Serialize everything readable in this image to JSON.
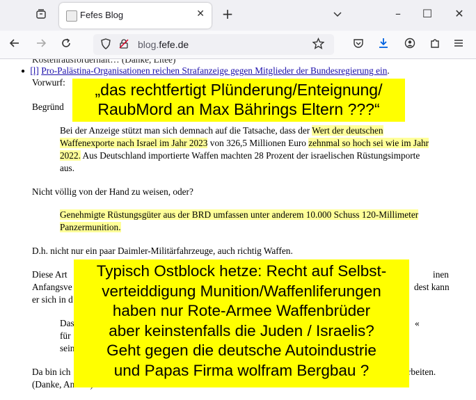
{
  "browser": {
    "tab_title": "Fefes Blog",
    "tab_close": "✕",
    "new_tab": "+",
    "url_prefix": "blog.",
    "url_domain": "fefe.de",
    "window_controls": {
      "minimize": "–",
      "maximize": "☐",
      "close": "✕"
    },
    "icons": [
      "tab-list-icon",
      "back-icon",
      "forward-icon",
      "reload-icon",
      "shield-icon",
      "permissions-icon",
      "bookmark-star-icon",
      "pocket-icon",
      "download-icon",
      "account-icon",
      "extensions-icon",
      "menu-icon"
    ]
  },
  "article": {
    "top_cut": "Kostenrausforderhalt… (Danke, Litee)",
    "bullet_marker": "[l]",
    "headline": "Pro-Palästina-Organisationen reichen Strafanzeige gegen Mitglieder der Bundesregierung ein",
    "headline_end": ".",
    "intro": "Vorwurf:",
    "begruendung": "Begründ",
    "quote1": {
      "part1": "Bei der Anzeige stützt man sich demnach auf die Tatsache, dass der ",
      "hl1": "Wert der deutschen Waffenexporte nach Israel im Jahr 2023",
      "part2": " von 326,5 Millionen Euro ",
      "hl2": "zehnmal so hoch sei wie im Jahr 2022.",
      "part3": " Aus Deutschland importierte Waffen machten 28 Prozent der israelischen Rüstungsimporte aus."
    },
    "comment1": "Nicht völlig von der Hand zu weisen, oder?",
    "quote2": "Genehmigte Rüstungsgüter aus der BRD umfassen unter anderem 10.000 Schuss 120-Millimeter Panzermunition.",
    "comment2": "D.h. nicht nur ein paar Daimler-Militärfahrzeuge, auch richtig Waffen.",
    "p3_line1_start": "Diese Art",
    "p3_line1_end": "inen",
    "p3_line2_start": "Anfangsve",
    "p3_line2_end": "dest kann",
    "p3_line3_start": "er sich in d",
    "q3_line1_start": "Das",
    "q3_line1_end": "«",
    "q3_line2_start": "für",
    "q3_line3_start": "sein",
    "last_line1_start": "Da bin ich",
    "last_line1_end": "rbeiten.",
    "last_line2": "(Danke, Anmea)"
  },
  "overlays": {
    "top": [
      "„das rechtfertigt Plünderung/Enteignung/",
      "RaubMord an Max Bährings Eltern ???“"
    ],
    "bottom": [
      "Typisch Ostblock hetze: Recht auf Selbst-",
      "verteiddigung Munition/Waffenliferungen",
      "haben nur Rote-Armee Waffenbrüder",
      "aber keinstenfalls die Juden / Israelis?",
      "Geht gegen die deutsche Autoindustrie",
      "und Papas Firma wolfram Bergbau ?"
    ]
  }
}
